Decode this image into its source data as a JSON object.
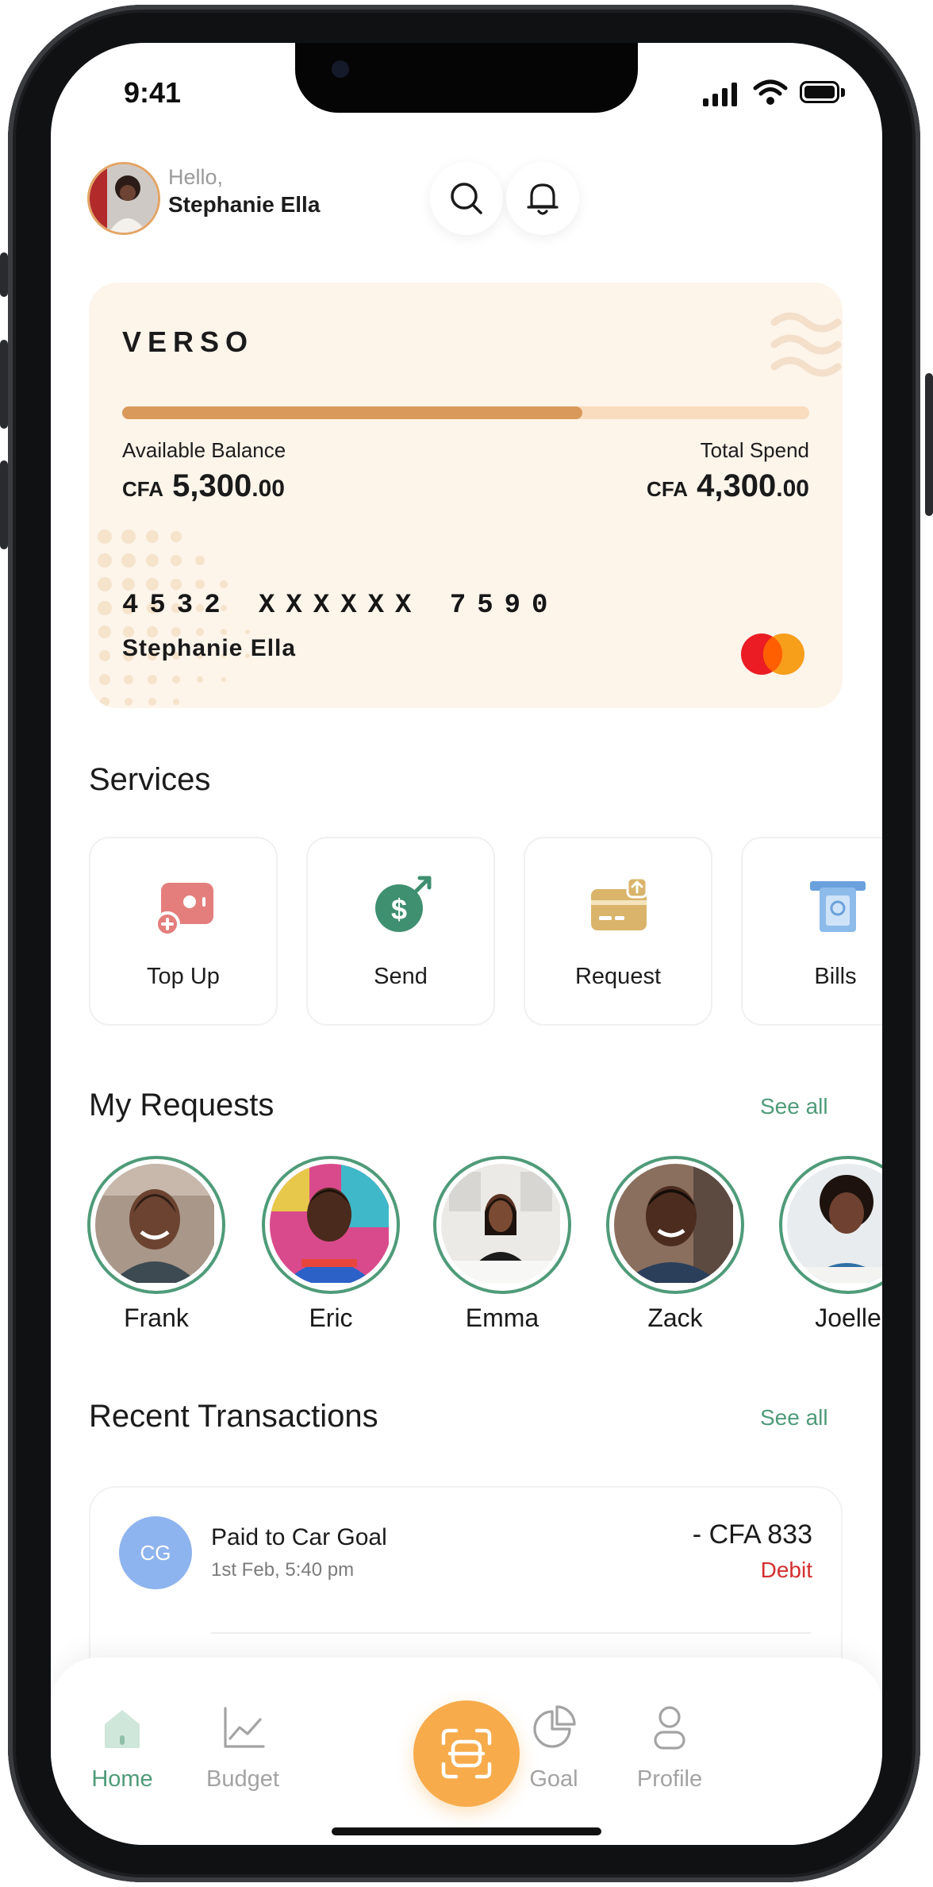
{
  "status_bar": {
    "time": "9:41"
  },
  "header": {
    "greeting": "Hello,",
    "user_name": "Stephanie Ella",
    "search_icon": "search-icon",
    "notification_icon": "bell-icon"
  },
  "card": {
    "brand": "VERSO",
    "spend_progress": 0.67,
    "available_label": "Available Balance",
    "available_currency": "CFA",
    "available_amount": "5,300",
    "available_decimals": ".00",
    "spend_label": "Total Spend",
    "spend_currency": "CFA",
    "spend_amount": "4,300",
    "spend_decimals": ".00",
    "number": "4532 XXXXXX 7590",
    "holder": "Stephanie Ella",
    "network_icon": "mastercard-logo-icon",
    "colors": {
      "background": "#fdf4ea",
      "progress": "#d9995a",
      "track": "#f8dcbd"
    }
  },
  "services": {
    "title": "Services",
    "items": [
      {
        "label": "Top Up",
        "icon": "top-up-icon"
      },
      {
        "label": "Send",
        "icon": "send-dollar-icon"
      },
      {
        "label": "Request",
        "icon": "request-card-icon"
      },
      {
        "label": "Bills",
        "icon": "bills-receipt-icon"
      }
    ]
  },
  "requests": {
    "title": "My Requests",
    "see_all": "See all",
    "people": [
      {
        "name": "Frank"
      },
      {
        "name": "Eric"
      },
      {
        "name": "Emma"
      },
      {
        "name": "Zack"
      },
      {
        "name": "Joelle"
      }
    ]
  },
  "transactions": {
    "title": "Recent Transactions",
    "see_all": "See all",
    "items": [
      {
        "initials": "CG",
        "title": "Paid to Car Goal",
        "date": "1st Feb, 5:40 pm",
        "amount": "- CFA 833",
        "status": "Debit"
      }
    ]
  },
  "bottom_nav": {
    "items": [
      {
        "label": "Home",
        "icon": "home-icon",
        "active": true
      },
      {
        "label": "Budget",
        "icon": "chart-icon",
        "active": false
      },
      {
        "label": "Goal",
        "icon": "pie-chart-icon",
        "active": false
      },
      {
        "label": "Profile",
        "icon": "profile-icon",
        "active": false
      }
    ],
    "scan_icon": "scan-icon"
  },
  "theme": {
    "accent": "#4f9b79",
    "scan": "#f7ab4b",
    "debit": "#d32f2f"
  }
}
